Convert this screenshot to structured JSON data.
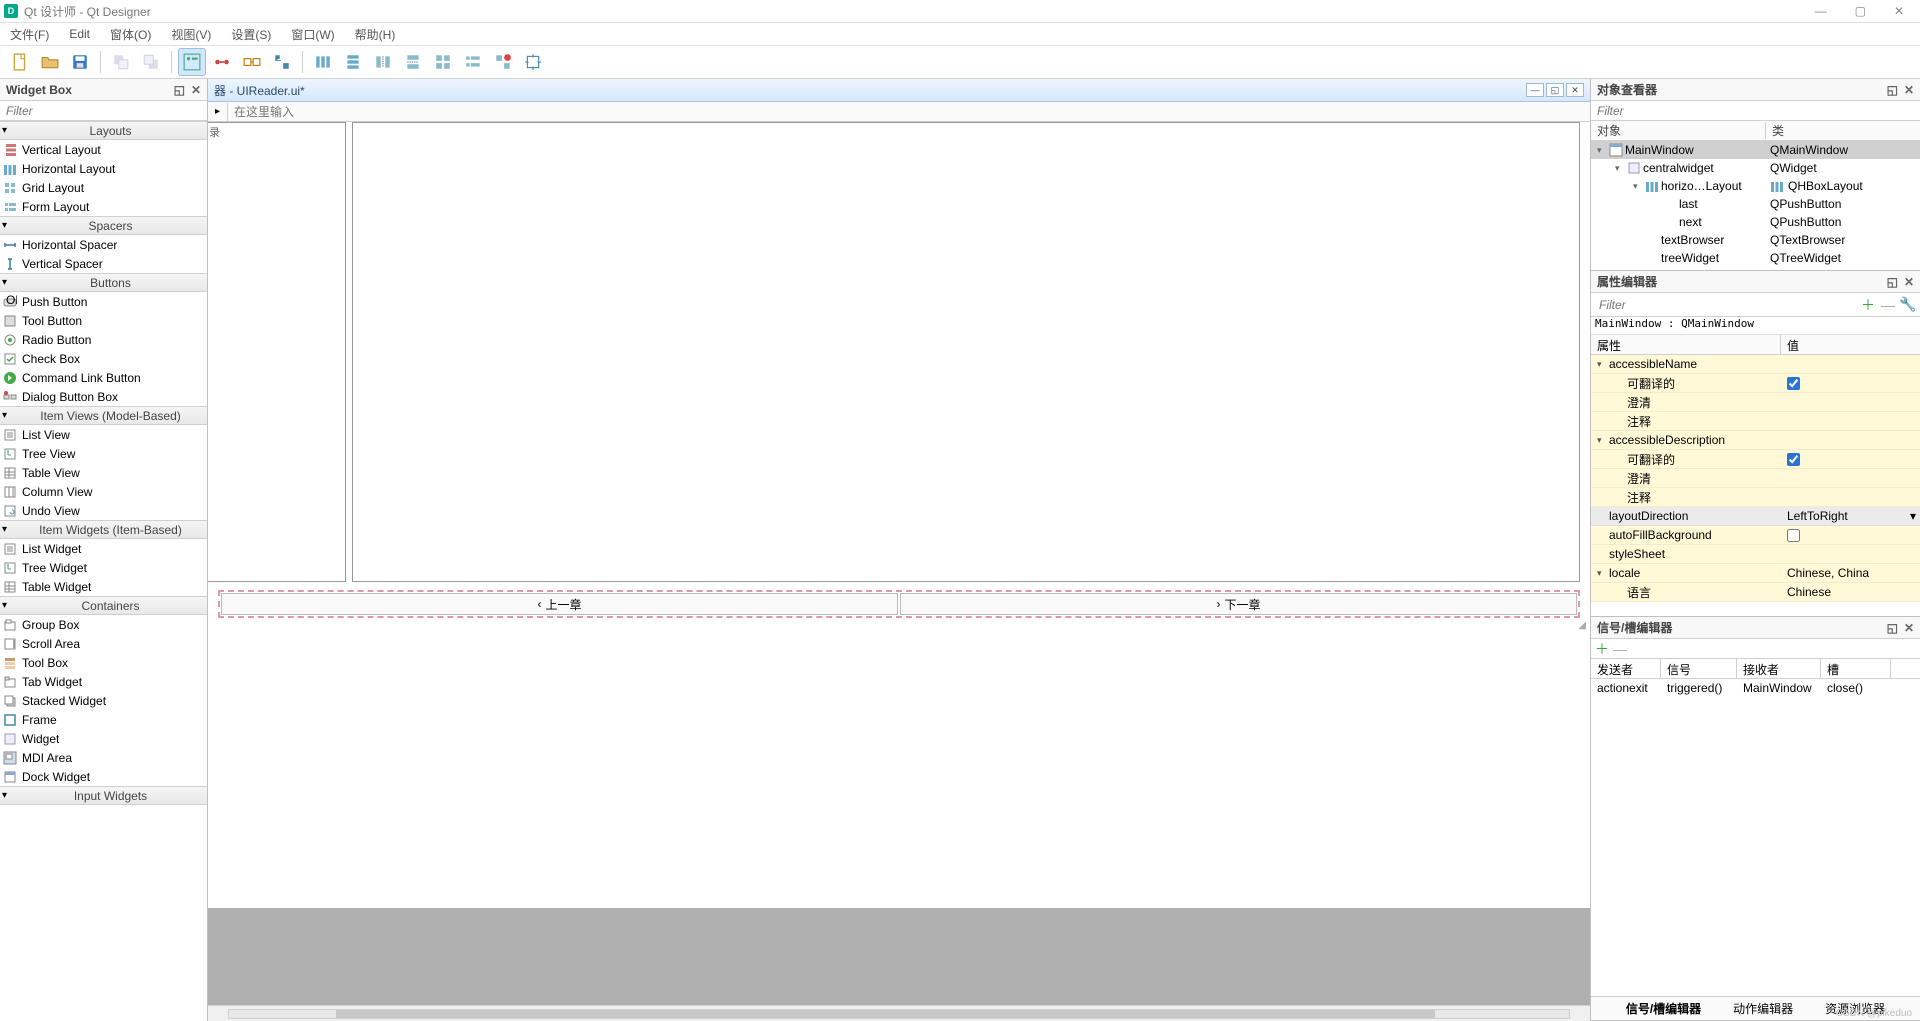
{
  "titlebar": {
    "app_icon_text": "D",
    "title": "Qt 设计师 - Qt Designer"
  },
  "menubar": [
    "文件(F)",
    "Edit",
    "窗体(O)",
    "视图(V)",
    "设置(S)",
    "窗口(W)",
    "帮助(H)"
  ],
  "widgetbox": {
    "title": "Widget Box",
    "filter_placeholder": "Filter",
    "categories": [
      {
        "name": "Layouts",
        "items": [
          {
            "icon": "vlayout",
            "label": "Vertical Layout"
          },
          {
            "icon": "hlayout",
            "label": "Horizontal Layout"
          },
          {
            "icon": "gridlayout",
            "label": "Grid Layout"
          },
          {
            "icon": "formlayout",
            "label": "Form Layout"
          }
        ]
      },
      {
        "name": "Spacers",
        "items": [
          {
            "icon": "hspacer",
            "label": "Horizontal Spacer"
          },
          {
            "icon": "vspacer",
            "label": "Vertical Spacer"
          }
        ]
      },
      {
        "name": "Buttons",
        "items": [
          {
            "icon": "pushbtn",
            "label": "Push Button"
          },
          {
            "icon": "toolbtn",
            "label": "Tool Button"
          },
          {
            "icon": "radiobtn",
            "label": "Radio Button"
          },
          {
            "icon": "checkbox",
            "label": "Check Box"
          },
          {
            "icon": "cmdlink",
            "label": "Command Link Button"
          },
          {
            "icon": "dlgbtn",
            "label": "Dialog Button Box"
          }
        ]
      },
      {
        "name": "Item Views (Model-Based)",
        "items": [
          {
            "icon": "listview",
            "label": "List View"
          },
          {
            "icon": "treeview",
            "label": "Tree View"
          },
          {
            "icon": "tableview",
            "label": "Table View"
          },
          {
            "icon": "columnview",
            "label": "Column View"
          },
          {
            "icon": "undoview",
            "label": "Undo View"
          }
        ]
      },
      {
        "name": "Item Widgets (Item-Based)",
        "items": [
          {
            "icon": "listview",
            "label": "List Widget"
          },
          {
            "icon": "treeview",
            "label": "Tree Widget"
          },
          {
            "icon": "tableview",
            "label": "Table Widget"
          }
        ]
      },
      {
        "name": "Containers",
        "items": [
          {
            "icon": "groupbox",
            "label": "Group Box"
          },
          {
            "icon": "scrollarea",
            "label": "Scroll Area"
          },
          {
            "icon": "toolbox",
            "label": "Tool Box"
          },
          {
            "icon": "tabwidget",
            "label": "Tab Widget"
          },
          {
            "icon": "stacked",
            "label": "Stacked Widget"
          },
          {
            "icon": "frame",
            "label": "Frame"
          },
          {
            "icon": "widget",
            "label": "Widget"
          },
          {
            "icon": "mdiarea",
            "label": "MDI Area"
          },
          {
            "icon": "dock",
            "label": "Dock Widget"
          }
        ]
      },
      {
        "name": "Input Widgets",
        "items": []
      }
    ]
  },
  "center": {
    "tab_title": "器 - UIReader.ui*",
    "toolbar_placeholder": "在这里输入",
    "tree_header": "录",
    "prev_btn": "上一章",
    "next_btn": "下一章"
  },
  "object_inspector": {
    "title": "对象查看器",
    "filter_placeholder": "Filter",
    "col1": "对象",
    "col2": "类",
    "rows": [
      {
        "depth": 0,
        "arrow": "▾",
        "icon": "win",
        "name": "MainWindow",
        "cls": "QMainWindow",
        "selected": true
      },
      {
        "depth": 1,
        "arrow": "▾",
        "icon": "widget",
        "name": "centralwidget",
        "cls": "QWidget"
      },
      {
        "depth": 2,
        "arrow": "▾",
        "icon": "hlayout",
        "name": "horizo…Layout",
        "cls": "QHBoxLayout",
        "clsicon": "hlayout"
      },
      {
        "depth": 3,
        "arrow": "",
        "icon": "",
        "name": "last",
        "cls": "QPushButton"
      },
      {
        "depth": 3,
        "arrow": "",
        "icon": "",
        "name": "next",
        "cls": "QPushButton"
      },
      {
        "depth": 2,
        "arrow": "",
        "icon": "",
        "name": "textBrowser",
        "cls": "QTextBrowser"
      },
      {
        "depth": 2,
        "arrow": "",
        "icon": "",
        "name": "treeWidget",
        "cls": "QTreeWidget"
      }
    ]
  },
  "property_editor": {
    "title": "属性编辑器",
    "filter_placeholder": "Filter",
    "class_line": "MainWindow : QMainWindow",
    "col1": "属性",
    "col2": "值",
    "rows": [
      {
        "type": "group",
        "label": "accessibleName",
        "depth": 0,
        "yellow": true,
        "arrow": "▾"
      },
      {
        "type": "prop",
        "label": "可翻译的",
        "depth": 1,
        "yellow": true,
        "value_type": "check",
        "checked": true
      },
      {
        "type": "prop",
        "label": "澄清",
        "depth": 1,
        "yellow": true,
        "value_type": "text",
        "value": ""
      },
      {
        "type": "prop",
        "label": "注释",
        "depth": 1,
        "yellow": true,
        "value_type": "text",
        "value": ""
      },
      {
        "type": "group",
        "label": "accessibleDescription",
        "depth": 0,
        "yellow": true,
        "arrow": "▾"
      },
      {
        "type": "prop",
        "label": "可翻译的",
        "depth": 1,
        "yellow": true,
        "value_type": "check",
        "checked": true
      },
      {
        "type": "prop",
        "label": "澄清",
        "depth": 1,
        "yellow": true,
        "value_type": "text",
        "value": ""
      },
      {
        "type": "prop",
        "label": "注释",
        "depth": 1,
        "yellow": true,
        "value_type": "text",
        "value": ""
      },
      {
        "type": "prop",
        "label": "layoutDirection",
        "depth": 0,
        "gray": true,
        "value_type": "combo",
        "value": "LeftToRight"
      },
      {
        "type": "prop",
        "label": "autoFillBackground",
        "depth": 0,
        "yellow": true,
        "value_type": "check",
        "checked": false
      },
      {
        "type": "prop",
        "label": "styleSheet",
        "depth": 0,
        "yellow": true,
        "value_type": "text",
        "value": ""
      },
      {
        "type": "group",
        "label": "locale",
        "depth": 0,
        "yellow": true,
        "arrow": "▾",
        "value": "Chinese, China"
      },
      {
        "type": "prop",
        "label": "语言",
        "depth": 1,
        "yellow": true,
        "value_type": "text",
        "value": "Chinese"
      }
    ]
  },
  "signal_editor": {
    "title": "信号/槽编辑器",
    "col1": "发送者",
    "col2": "信号",
    "col3": "接收者",
    "col4": "槽",
    "rows": [
      {
        "sender": "actionexit",
        "signal": "triggered()",
        "receiver": "MainWindow",
        "slot": "close()"
      }
    ],
    "tabs": [
      "信号/槽编辑器",
      "动作编辑器",
      "资源浏览器"
    ]
  },
  "watermark": "CSDN @pikeduo"
}
